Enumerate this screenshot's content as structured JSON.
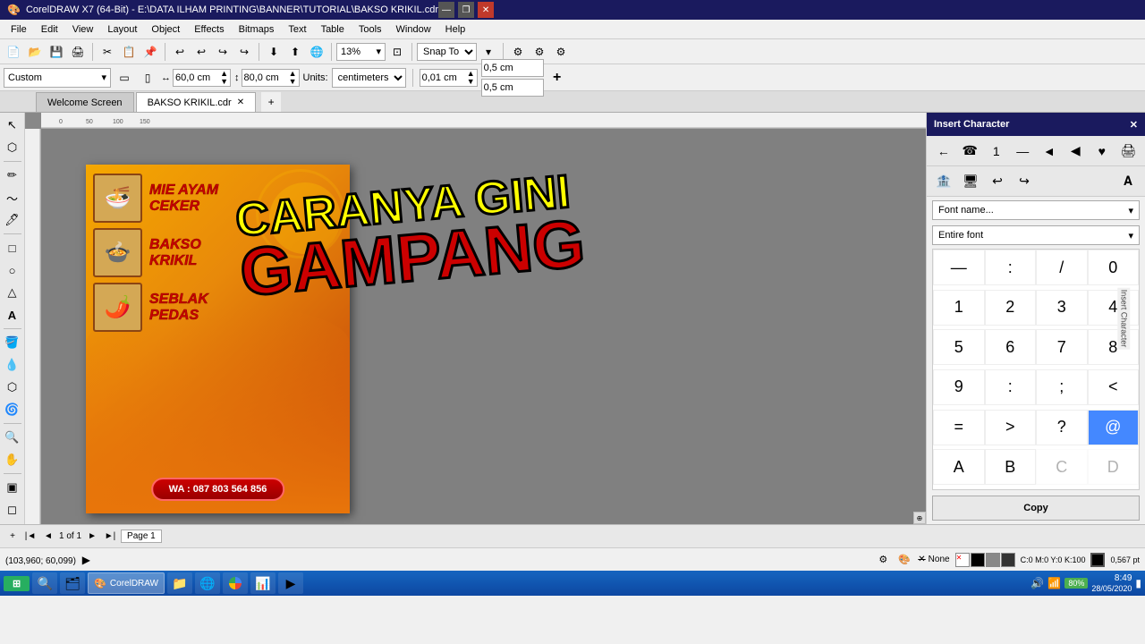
{
  "titlebar": {
    "title": "CorelDRAW X7 (64-Bit) - E:\\DATA ILHAM PRINTING\\BANNER\\TUTORIAL\\BAKSO KRIKIL.cdr",
    "min": "—",
    "max": "❐",
    "close": "✕"
  },
  "menubar": {
    "items": [
      "File",
      "Edit",
      "View",
      "Layout",
      "Object",
      "Effects",
      "Bitmaps",
      "Text",
      "Table",
      "Tools",
      "Window",
      "Help"
    ]
  },
  "toolbar": {
    "zoom": "13%",
    "snap": "Snap To"
  },
  "propertybar": {
    "preset": "Custom",
    "width": "60,0 cm",
    "height": "80,0 cm",
    "units": "centimeters",
    "nudge": "0,01 cm",
    "nudge2": "0,5 cm",
    "nudge3": "0,5 cm"
  },
  "tabs": [
    {
      "label": "Welcome Screen",
      "active": false
    },
    {
      "label": "BAKSO KRIKIL.cdr",
      "active": true
    }
  ],
  "banner": {
    "items": [
      {
        "name": "MIE AYAM CEKER",
        "emoji": "🍜"
      },
      {
        "name": "BAKSO KRIKIL",
        "emoji": "🍲"
      },
      {
        "name": "SEBLAK PEDAS",
        "emoji": "🌶️"
      }
    ],
    "wa": "WA : 087 803 564 856",
    "overlay_line1": "CARANYA GINI",
    "overlay_line2": "",
    "overlay_line3": "GAMPANG"
  },
  "insert_character": {
    "title": "Insert Character",
    "label": "Insert Character",
    "chars": [
      "←",
      "☎",
      "1",
      "—",
      "◄",
      "◀",
      "♥",
      "🖨",
      "🏦",
      "🖥",
      "↩",
      "↪",
      "—",
      ":",
      "/",
      "0",
      "1",
      "2",
      "3",
      "4",
      "5",
      "6",
      "7",
      "8",
      "9",
      ":",
      ";",
      "<",
      "=",
      ">",
      "?",
      "@",
      "A",
      "B",
      "C",
      "D"
    ],
    "copy_btn": "Copy"
  },
  "statusbar": {
    "coordinates": "(103,960; 60,099)",
    "color_fill": "None",
    "color_stroke": "C:0 M:0 Y:0 K:100",
    "stroke_width": "0,567 pt",
    "page": "1 of 1",
    "page_name": "Page 1"
  },
  "taskbar": {
    "start": "⊞",
    "apps": [
      {
        "label": "Search",
        "icon": "🔍",
        "active": false
      },
      {
        "label": "Corel",
        "icon": "🖊",
        "active": true
      },
      {
        "label": "File Explorer",
        "icon": "📁",
        "active": false
      },
      {
        "label": "Chrome",
        "icon": "🌐",
        "active": false
      },
      {
        "label": "Excel",
        "icon": "📊",
        "active": false
      },
      {
        "label": "Media",
        "icon": "▶",
        "active": false
      }
    ],
    "time": "8:49",
    "date": "28/05/2020",
    "battery": "80%"
  }
}
